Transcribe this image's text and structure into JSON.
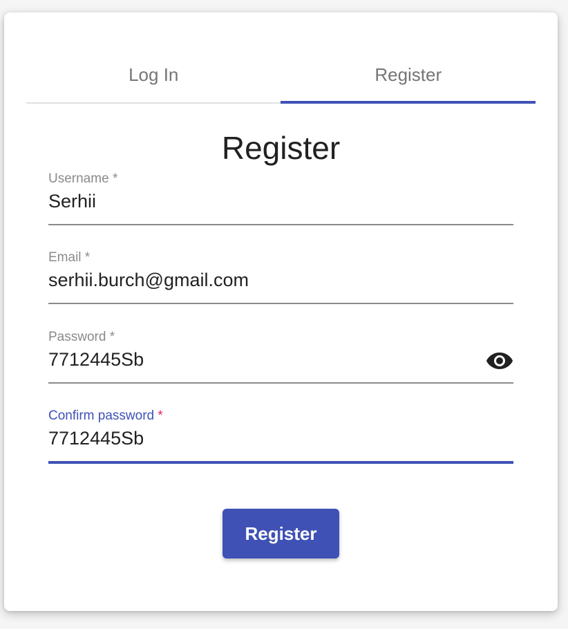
{
  "tabs": [
    {
      "label": "Log In",
      "selected": false
    },
    {
      "label": "Register",
      "selected": true
    }
  ],
  "form": {
    "title": "Register",
    "fields": [
      {
        "label": "Username",
        "required_mark": "*",
        "value": "Serhii"
      },
      {
        "label": "Email",
        "required_mark": "*",
        "value": "serhii.burch@gmail.com"
      },
      {
        "label": "Password",
        "required_mark": "*",
        "value": "7712445Sb",
        "icon": "eye-icon"
      },
      {
        "label": "Confirm password",
        "required_mark": "*",
        "value": "7712445Sb",
        "focused": true
      }
    ],
    "submit_label": "Register"
  },
  "colors": {
    "primary": "#3f51b5",
    "required_focused": "#e91e63",
    "label": "#8a8a8a",
    "text": "#212121"
  }
}
